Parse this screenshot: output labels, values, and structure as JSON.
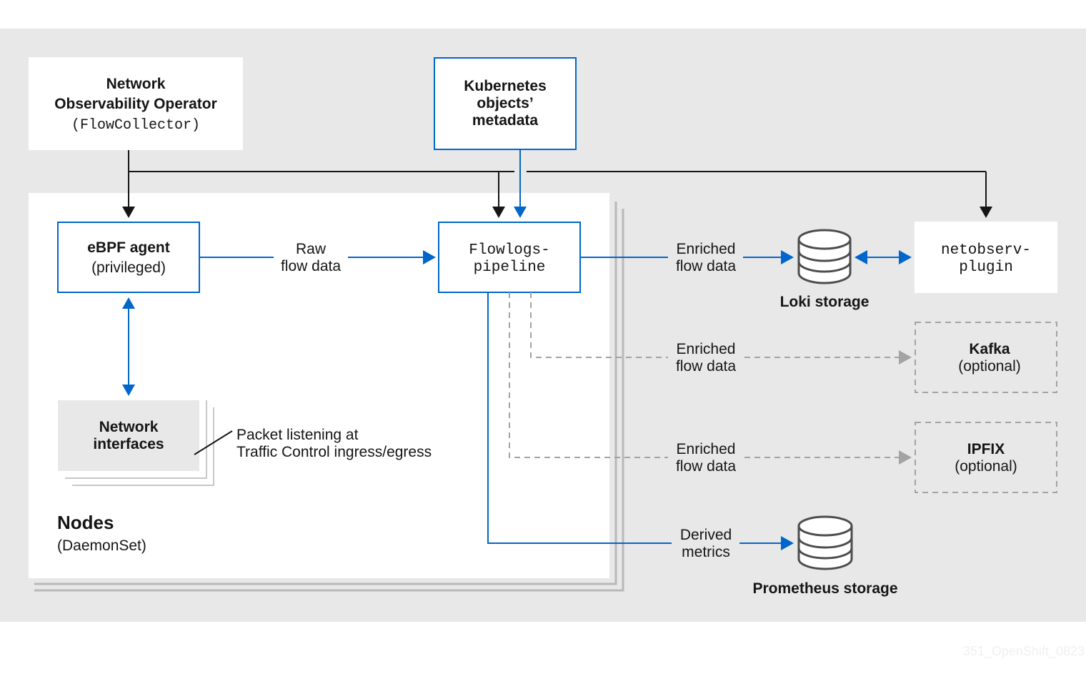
{
  "diagram": {
    "colors": {
      "background_panel": "#e8e8e8",
      "node_fill": "#ffffff",
      "accent_blue": "#0066cc",
      "line_black": "#151515",
      "dashed_gray": "#a3a3a3",
      "stack_gray": "#b8b8b8",
      "watermark": "#f0f0f0"
    },
    "operator": {
      "line1": "Network",
      "line2": "Observability Operator",
      "line3": "(FlowCollector)"
    },
    "k8s_metadata": {
      "line1": "Kubernetes",
      "line2": "objects’",
      "line3": "metadata"
    },
    "ebpf_agent": {
      "line1": "eBPF agent",
      "line2": "(privileged)"
    },
    "raw_flow_label": {
      "line1": "Raw",
      "line2": "flow data"
    },
    "flowlogs_pipeline": {
      "line1": "Flowlogs-",
      "line2": "pipeline"
    },
    "network_interfaces": {
      "line1": "Network",
      "line2": "interfaces"
    },
    "packet_note": {
      "line1": "Packet listening at",
      "line2": "Traffic Control ingress/egress"
    },
    "nodes_group": {
      "title": "Nodes",
      "subtitle": "(DaemonSet)"
    },
    "edges": {
      "loki_edge": {
        "line1": "Enriched",
        "line2": "flow data"
      },
      "kafka_edge": {
        "line1": "Enriched",
        "line2": "flow data"
      },
      "ipfix_edge": {
        "line1": "Enriched",
        "line2": "flow data"
      },
      "metrics_edge": {
        "line1": "Derived",
        "line2": "metrics"
      }
    },
    "loki": {
      "label": "Loki storage"
    },
    "prometheus": {
      "label": "Prometheus storage"
    },
    "plugin": {
      "line1": "netobserv-",
      "line2": "plugin"
    },
    "kafka": {
      "line1": "Kafka",
      "line2": "(optional)"
    },
    "ipfix": {
      "line1": "IPFIX",
      "line2": "(optional)"
    },
    "watermark": "351_OpenShift_0823"
  }
}
